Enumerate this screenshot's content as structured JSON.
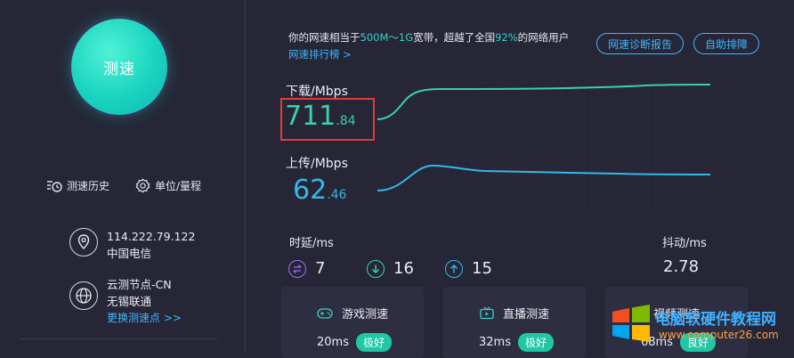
{
  "left": {
    "speed_button_label": "测速",
    "history_label": "测速历史",
    "unit_label": "单位/量程",
    "ip": "114.222.79.122",
    "isp": "中国电信",
    "node_name": "云测节点-CN",
    "node_location": "无锡联通",
    "change_node_label": "更换测速点 >>"
  },
  "summary": {
    "prefix": "你的网速相当于",
    "bandwidth": "500M～1G",
    "middle": "宽带，超越了全国",
    "percent": "92%",
    "suffix": "的网络用户",
    "rank_link": "网速排行榜 >"
  },
  "buttons": {
    "diagnose": "网速诊断报告",
    "self_check": "自助排障"
  },
  "download": {
    "label": "下载/Mbps",
    "int_part": "711",
    "frac_part": ".84"
  },
  "upload": {
    "label": "上传/Mbps",
    "int_part": "62",
    "frac_part": ".46"
  },
  "latency": {
    "label": "时延/ms",
    "values": [
      "7",
      "16",
      "15"
    ]
  },
  "jitter": {
    "label": "抖动/ms",
    "value": "2.78"
  },
  "cards": [
    {
      "title": "游戏测速",
      "value": "20ms",
      "badge": "极好"
    },
    {
      "title": "直播测速",
      "value": "32ms",
      "badge": "极好"
    },
    {
      "title": "视频测速",
      "value": "68ms",
      "badge": "良好"
    }
  ],
  "watermark": {
    "title": "电脑软硬件教程网",
    "url": "www.computer26.com"
  },
  "colors": {
    "background": "#262636",
    "accent_teal": "#19d3be",
    "download_line": "#3ad1a8",
    "upload_line": "#35b8e8",
    "link_blue": "#3fb6ff",
    "highlight_red": "#e23b3b",
    "badge_green": "#1fc7a4"
  }
}
